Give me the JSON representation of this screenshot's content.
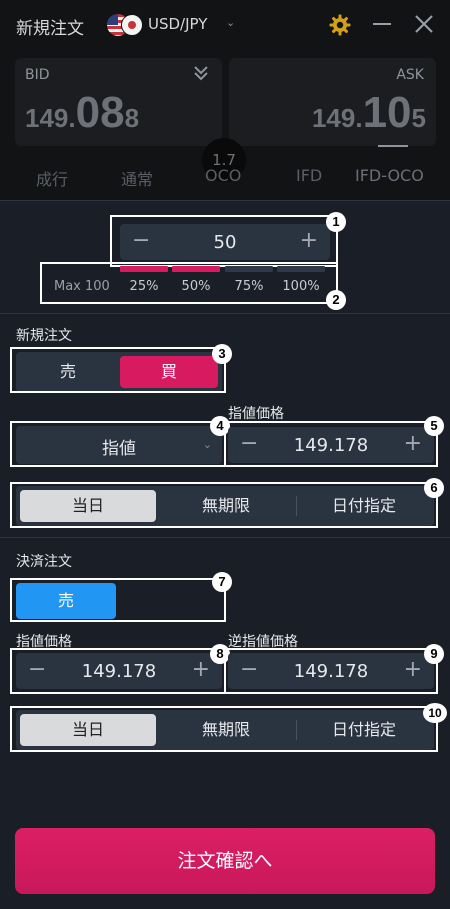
{
  "header": {
    "title": "新規注文",
    "pair": "USD/JPY"
  },
  "quotes": {
    "bid_label": "BID",
    "bid_prefix": "149.",
    "bid_big": "08",
    "bid_last": "8",
    "ask_label": "ASK",
    "ask_prefix": "149.",
    "ask_big": "10",
    "ask_last": "5",
    "spread": "1.7"
  },
  "tabs": [
    "成行",
    "通常",
    "OCO",
    "IFD",
    "IFD-OCO"
  ],
  "active_tab": "IFD-OCO",
  "quantity": {
    "value": "50",
    "minus": "−",
    "plus": "+",
    "max_label": "Max 100",
    "percent_options": [
      "25%",
      "50%",
      "75%",
      "100%"
    ],
    "selected_percent": [
      "25%",
      "50%"
    ]
  },
  "new_order": {
    "section_title": "新規注文",
    "side_options": [
      "売",
      "買"
    ],
    "selected_side": "買",
    "order_type": "指値",
    "price_label": "指値価格",
    "price_value": "149.178",
    "expiry_options": [
      "当日",
      "無期限",
      "日付指定"
    ],
    "selected_expiry": "当日"
  },
  "settlement": {
    "section_title": "決済注文",
    "side": "売",
    "limit_label": "指値価格",
    "limit_value": "149.178",
    "stop_label": "逆指値価格",
    "stop_value": "149.178",
    "expiry_options": [
      "当日",
      "無期限",
      "日付指定"
    ],
    "selected_expiry": "当日"
  },
  "badges": [
    "1",
    "2",
    "3",
    "4",
    "5",
    "6",
    "7",
    "8",
    "9",
    "10"
  ],
  "confirm_button": "注文確認へ",
  "colors": {
    "accent": "#d81b60",
    "sell_blue": "#2196f3",
    "panel_bg": "#1a1f27",
    "header_bg": "#121315",
    "control_bg": "#2a3340"
  }
}
